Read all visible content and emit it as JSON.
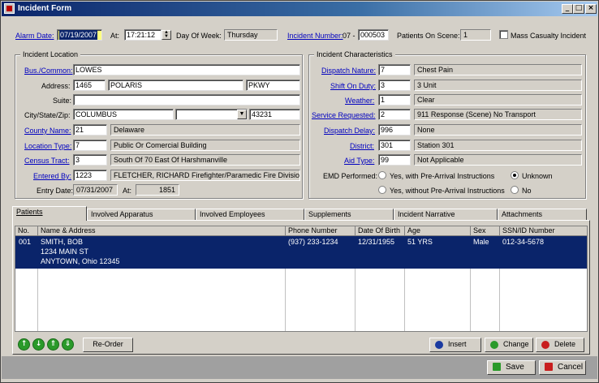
{
  "window": {
    "title": "Incident Form"
  },
  "header": {
    "alarm_date_label": "Alarm Date:",
    "alarm_date": "07/19/2007",
    "at_label": "At:",
    "alarm_time": "17:21:12",
    "dow_label": "Day Of Week:",
    "dow": "Thursday",
    "incident_number_label": "Incident Number:",
    "incident_prefix": "07 -",
    "incident_number": "000503",
    "patients_label": "Patients On Scene:",
    "patients_count": "1",
    "mass_casualty_label": "Mass Casualty Incident"
  },
  "location": {
    "group_title": "Incident Location",
    "bus_label": "Bus./Common:",
    "bus_value": "LOWES",
    "address_label": "Address:",
    "addr_num": "1465",
    "addr_street": "POLARIS",
    "addr_type": "PKWY",
    "suite_label": "Suite:",
    "suite_value": "",
    "city_label": "City/State/Zip:",
    "city": "COLUMBUS",
    "state": "",
    "zip": "43231",
    "county_label": "County Name:",
    "county_code": "21",
    "county_name": "Delaware",
    "loctype_label": "Location Type:",
    "loctype_code": "7",
    "loctype_name": "Public Or Comercial Building",
    "census_label": "Census Tract:",
    "census_code": "3",
    "census_name": "South Of 70 East Of Harshmanville",
    "entered_label": "Entered By:",
    "entered_code": "1223",
    "entered_name": "FLETCHER, RICHARD Firefighter/Paramedic Fire Division",
    "entry_date_label": "Entry Date:",
    "entry_date": "07/31/2007",
    "entry_at_label": "At:",
    "entry_time": "1851"
  },
  "characteristics": {
    "group_title": "Incident Characteristics",
    "rows": [
      {
        "label": "Dispatch Nature:",
        "code": "7",
        "text": "Chest Pain"
      },
      {
        "label": "Shift On Duty:",
        "code": "3",
        "text": "3 Unit"
      },
      {
        "label": "Weather:",
        "code": "1",
        "text": "Clear"
      },
      {
        "label": "Service Requested:",
        "code": "2",
        "text": "911 Response (Scene) No Transport"
      },
      {
        "label": "Dispatch Delay:",
        "code": "996",
        "text": "None"
      },
      {
        "label": "District:",
        "code": "301",
        "text": "Station 301"
      },
      {
        "label": "Aid Type:",
        "code": "99",
        "text": "Not Applicable"
      }
    ],
    "emd_label": "EMD Performed:",
    "emd_opt1": "Yes, with Pre-Arrival Instructions",
    "emd_opt2": "Unknown",
    "emd_opt3": "Yes, without Pre-Arrival Instructions",
    "emd_opt4": "No",
    "emd_selected": "Unknown"
  },
  "tabs": [
    "Patients",
    "Involved Apparatus",
    "Involved Employees",
    "Supplements",
    "Incident Narrative",
    "Attachments"
  ],
  "grid": {
    "headers": [
      "No.",
      "Name & Address",
      "Phone Number",
      "Date Of Birth",
      "Age",
      "Sex",
      "SSN/ID Number"
    ],
    "rows": [
      {
        "no": "001",
        "name": "SMITH, BOB",
        "addr1": "1234 MAIN ST",
        "addr2": "ANYTOWN, Ohio 12345",
        "phone": "(937) 233-1234",
        "dob": "12/31/1955",
        "age": "51 YRS",
        "sex": "Male",
        "ssn": "012-34-5678"
      }
    ]
  },
  "buttons": {
    "reorder": "Re-Order",
    "insert": "Insert",
    "change": "Change",
    "delete": "Delete",
    "save": "Save",
    "cancel": "Cancel"
  },
  "icons": {
    "up": "arrow-up-icon",
    "down": "arrow-down-icon",
    "top": "arrow-top-icon",
    "bottom": "arrow-bottom-icon"
  },
  "colors": {
    "titlebar": "#0a246a",
    "selection": "#0a246a",
    "link": "#0000c0",
    "highlight_field": "#ffff80"
  }
}
